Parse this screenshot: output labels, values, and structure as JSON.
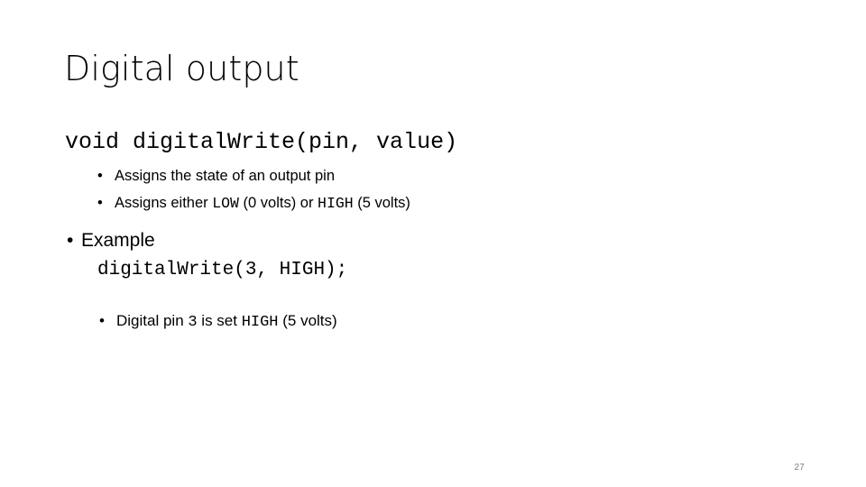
{
  "slide": {
    "title": "Digital output",
    "page_number": "27",
    "background_color": "#ffffff",
    "text_color": "#000000",
    "page_number_color": "#808080"
  },
  "signature": {
    "code": "void digitalWrite(pin, value)"
  },
  "sub_bullets": [
    {
      "bullet": "•",
      "parts": [
        {
          "text": "Assigns the state of an output pin",
          "style": "sans"
        }
      ]
    },
    {
      "bullet": "•",
      "parts": [
        {
          "text": "Assigns either ",
          "style": "sans"
        },
        {
          "text": "LOW",
          "style": "mono"
        },
        {
          "text": " (0 volts) or ",
          "style": "sans"
        },
        {
          "text": "HIGH",
          "style": "mono"
        },
        {
          "text": " (5 volts)",
          "style": "sans"
        }
      ]
    }
  ],
  "example": {
    "bullet": "•",
    "label": "Example",
    "code": "digitalWrite(3, HIGH);"
  },
  "note": {
    "bullet": "•",
    "parts": [
      {
        "text": "Digital pin ",
        "style": "sans"
      },
      {
        "text": "3",
        "style": "mono"
      },
      {
        "text": "  is set ",
        "style": "sans"
      },
      {
        "text": "HIGH",
        "style": "mono"
      },
      {
        "text": " (5 volts)",
        "style": "sans"
      }
    ]
  }
}
